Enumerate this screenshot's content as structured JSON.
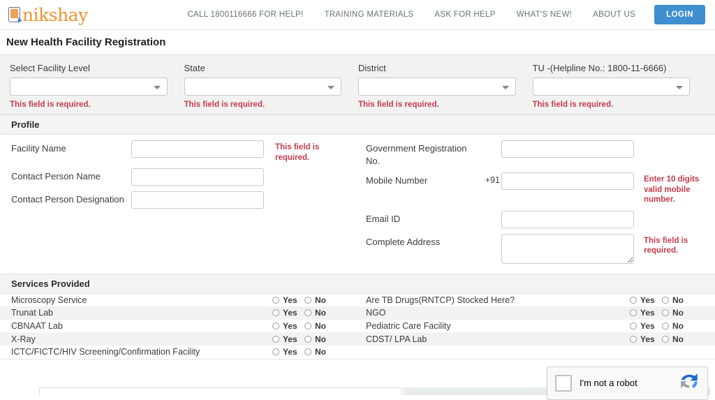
{
  "header": {
    "logo_text": "nikshay",
    "nav": [
      {
        "label": "CALL 1800116666 FOR HELP!"
      },
      {
        "label": "TRAINING MATERIALS"
      },
      {
        "label": "ASK FOR HELP"
      },
      {
        "label": "WHAT'S NEW!"
      },
      {
        "label": "ABOUT US"
      }
    ],
    "login_label": "LOGIN"
  },
  "page": {
    "title": "New Health Facility Registration"
  },
  "selectors": {
    "required_error": "This field is required.",
    "fields": [
      {
        "label": "Select Facility Level",
        "value": "",
        "error": "This field is required."
      },
      {
        "label": "State",
        "value": "",
        "error": "This field is required."
      },
      {
        "label": "District",
        "value": "",
        "error": "This field is required."
      },
      {
        "label": "TU -(Helpline No.: 1800-11-6666)",
        "value": "",
        "error": "This field is required."
      }
    ]
  },
  "profile": {
    "title": "Profile",
    "left": [
      {
        "label": "Facility Name",
        "value": "",
        "error": "This field is required."
      },
      {
        "label": "Contact Person Name",
        "value": "",
        "error": ""
      },
      {
        "label": "Contact Person Designation",
        "value": "",
        "error": ""
      }
    ],
    "right": [
      {
        "label": "Government Registration No.",
        "value": "",
        "error": ""
      },
      {
        "label": "Mobile Number",
        "prefix": "+91",
        "value": "",
        "error": "Enter 10 digits valid mobile number."
      },
      {
        "label": "Email ID",
        "value": "",
        "error": ""
      },
      {
        "label": "Complete Address",
        "value": "",
        "error": "This field is required."
      }
    ]
  },
  "services": {
    "title": "Services Provided",
    "yes_label": "Yes",
    "no_label": "No",
    "left": [
      {
        "label": "Microscopy Service",
        "selected": ""
      },
      {
        "label": "Trunat Lab",
        "selected": ""
      },
      {
        "label": "CBNAAT Lab",
        "selected": ""
      },
      {
        "label": "X-Ray",
        "selected": ""
      },
      {
        "label": "ICTC/FICTC/HIV Screening/Confirmation Facility",
        "selected": ""
      }
    ],
    "right": [
      {
        "label": "Are TB Drugs(RNTCP) Stocked Here?",
        "selected": ""
      },
      {
        "label": "NGO",
        "selected": ""
      },
      {
        "label": "Pediatric Care Facility",
        "selected": ""
      },
      {
        "label": "CDST/ LPA Lab",
        "selected": ""
      }
    ]
  },
  "captcha": {
    "label": "I'm not a robot"
  },
  "colors": {
    "brand_orange": "#f0922f",
    "accent_blue": "#3e8ed0",
    "error_red": "#c63c4c",
    "band_grey": "#f2f2f2"
  }
}
